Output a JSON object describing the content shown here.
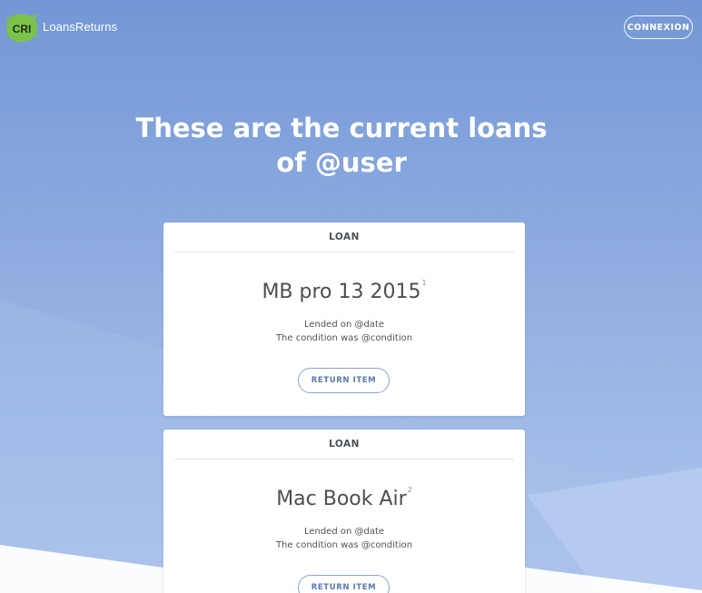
{
  "app": {
    "logo_text": "CRI",
    "name": "LoansReturns"
  },
  "header": {
    "connexion_label": "CONNEXION"
  },
  "page": {
    "headline_line1": "These are the current loans",
    "headline_line2": "of @user"
  },
  "loans": [
    {
      "header": "LOAN",
      "title": "MB pro 13 2015",
      "index": "1",
      "lended_text": "Lended on @date",
      "condition_text": "The condition was @condition",
      "return_label": "RETURN ITEM"
    },
    {
      "header": "LOAN",
      "title": "Mac Book Air",
      "index": "2",
      "lended_text": "Lended on @date",
      "condition_text": "The condition was @condition",
      "return_label": "RETURN ITEM"
    }
  ],
  "colors": {
    "background_top": "#7397d6",
    "background_bottom": "#afc6ee",
    "logo_green": "#7cc24a",
    "button_text": "#5b78ad"
  }
}
